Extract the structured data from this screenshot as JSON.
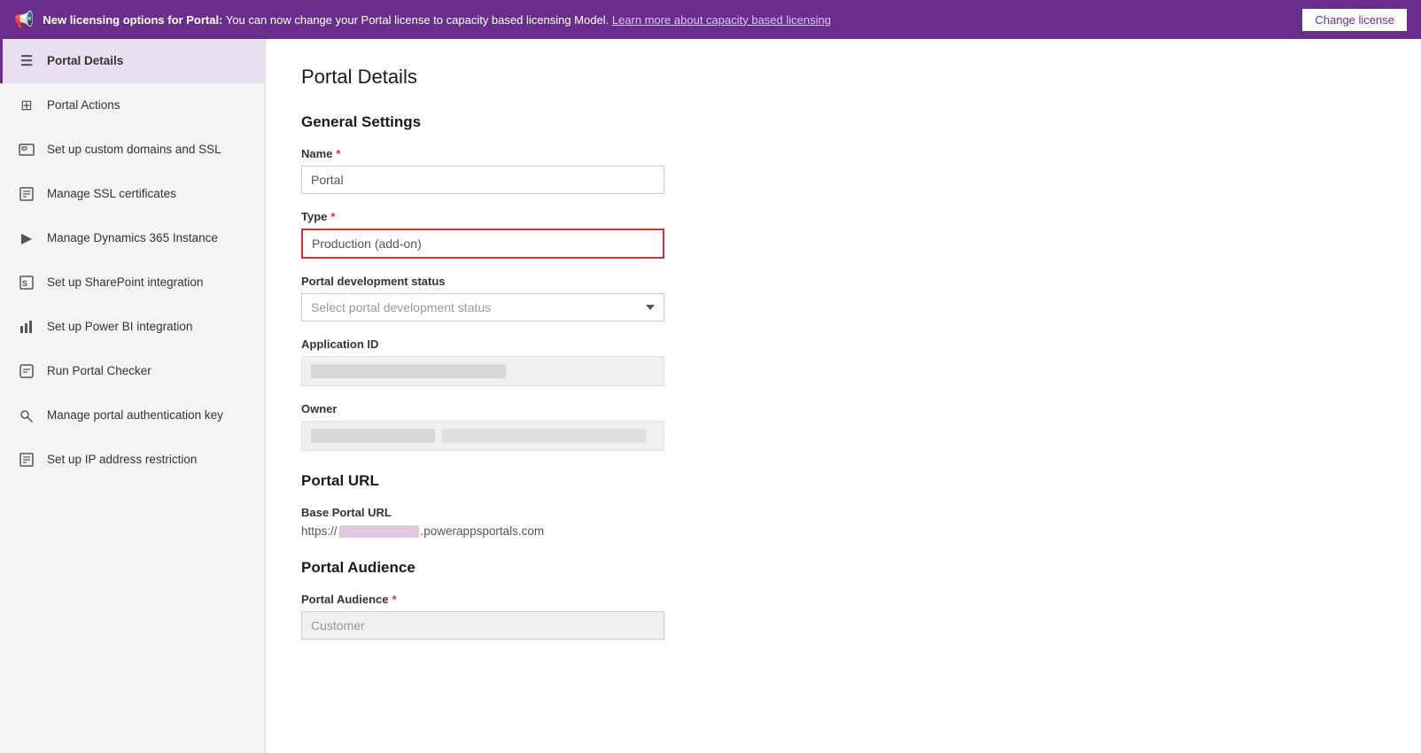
{
  "banner": {
    "icon": "📢",
    "bold_text": "New licensing options for Portal:",
    "text": " You can now change your Portal license to capacity based licensing Model.",
    "link_text": "Learn more about capacity based licensing",
    "button_label": "Change license"
  },
  "sidebar": {
    "items": [
      {
        "id": "portal-details",
        "label": "Portal Details",
        "icon": "☰",
        "active": true
      },
      {
        "id": "portal-actions",
        "label": "Portal Actions",
        "icon": "⊞",
        "active": false
      },
      {
        "id": "custom-domains",
        "label": "Set up custom domains and SSL",
        "icon": "⊟",
        "active": false
      },
      {
        "id": "ssl-certs",
        "label": "Manage SSL certificates",
        "icon": "📄",
        "active": false
      },
      {
        "id": "dynamics-365",
        "label": "Manage Dynamics 365 Instance",
        "icon": "▶",
        "active": false
      },
      {
        "id": "sharepoint",
        "label": "Set up SharePoint integration",
        "icon": "S",
        "active": false
      },
      {
        "id": "power-bi",
        "label": "Set up Power BI integration",
        "icon": "📊",
        "active": false
      },
      {
        "id": "portal-checker",
        "label": "Run Portal Checker",
        "icon": "⊞",
        "active": false
      },
      {
        "id": "auth-key",
        "label": "Manage portal authentication key",
        "icon": "🔒",
        "active": false
      },
      {
        "id": "ip-restriction",
        "label": "Set up IP address restriction",
        "icon": "📋",
        "active": false
      }
    ]
  },
  "page": {
    "title": "Portal Details",
    "sections": {
      "general": {
        "title": "General Settings",
        "name_label": "Name",
        "name_value": "Portal",
        "type_label": "Type",
        "type_value": "Production (add-on)",
        "dev_status_label": "Portal development status",
        "dev_status_placeholder": "Select portal development status",
        "app_id_label": "Application ID",
        "owner_label": "Owner"
      },
      "portal_url": {
        "title": "Portal URL",
        "base_url_label": "Base Portal URL",
        "base_url_prefix": "https://",
        "base_url_suffix": ".powerappsportals.com"
      },
      "audience": {
        "title": "Portal Audience",
        "label": "Portal Audience",
        "value": "Customer"
      }
    }
  }
}
